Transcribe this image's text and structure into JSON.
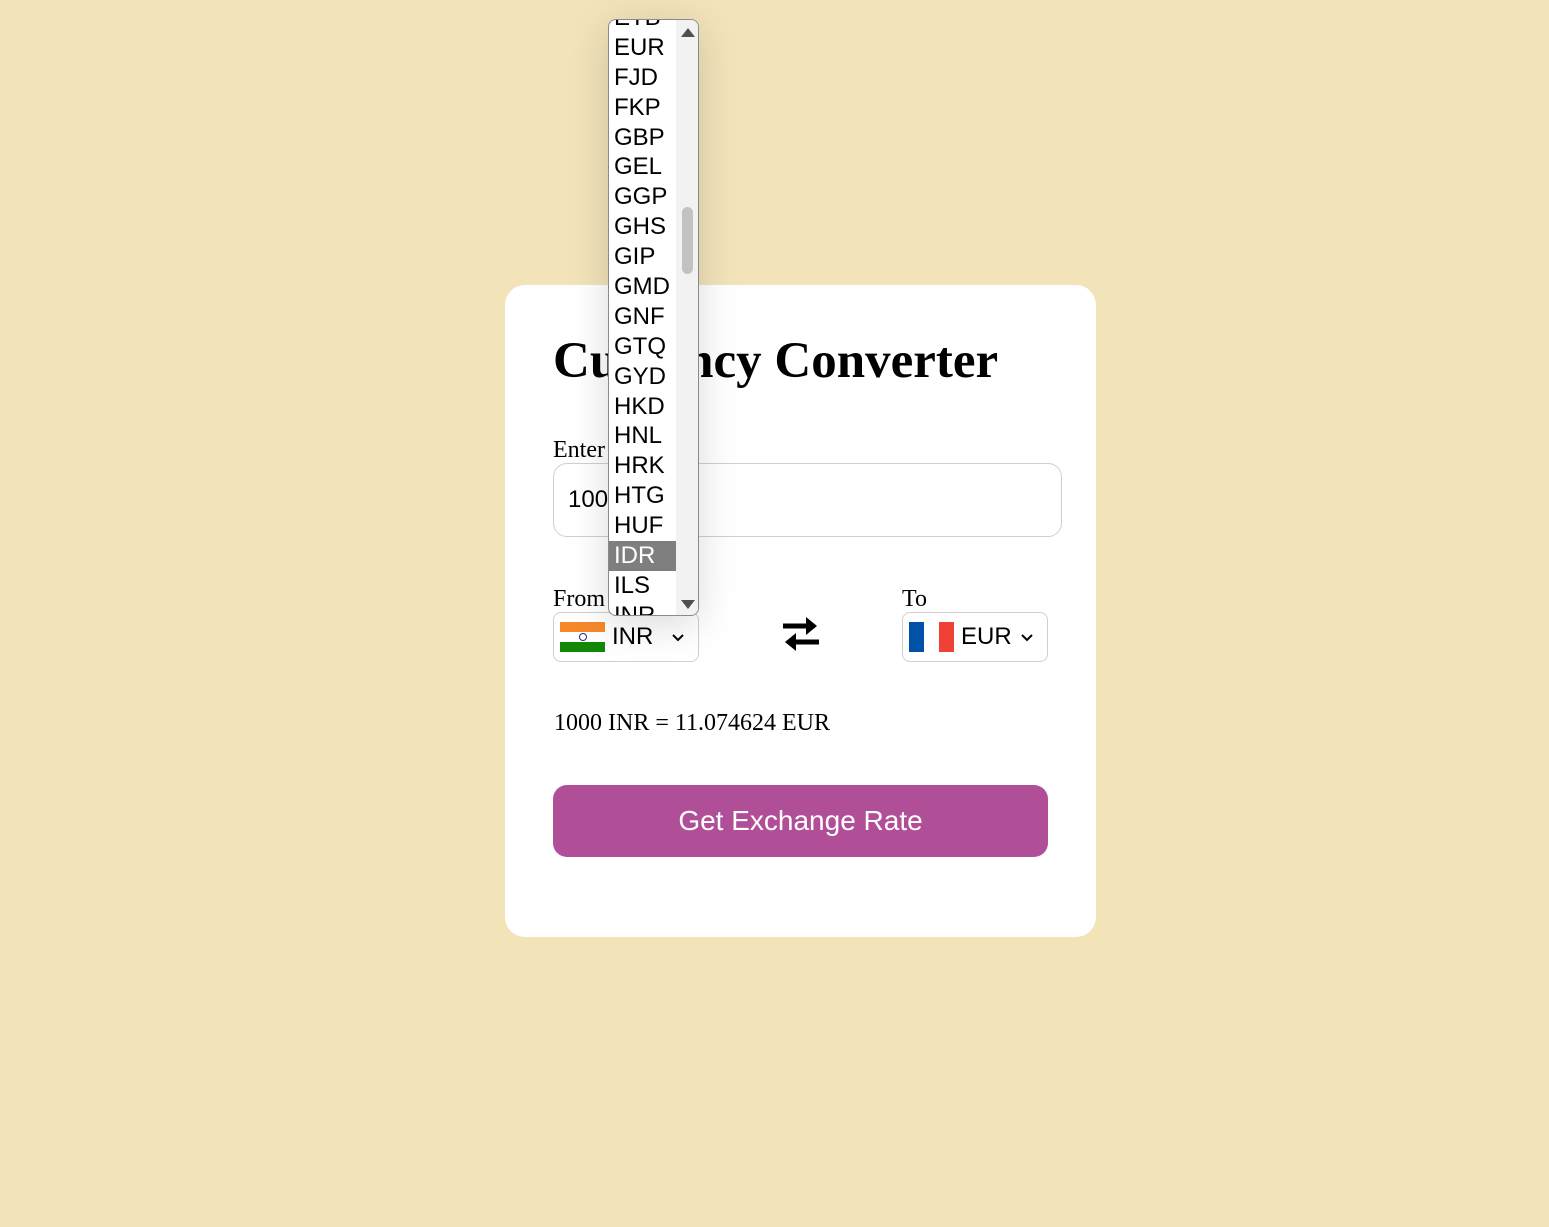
{
  "app": {
    "title": "Currency Converter"
  },
  "amount": {
    "label": "Enter Amount",
    "value": "1000"
  },
  "from": {
    "label": "From",
    "currency": "INR",
    "flag": "india-flag-icon"
  },
  "to": {
    "label": "To",
    "currency": "EUR",
    "flag": "france-flag-icon"
  },
  "swap_icon": "swap-arrows-icon",
  "result": "1000 INR = 11.074624 EUR",
  "button": {
    "label": "Get Exchange Rate",
    "color": "#b04f98"
  },
  "dropdown": {
    "options": [
      "ETB",
      "EUR",
      "FJD",
      "FKP",
      "GBP",
      "GEL",
      "GGP",
      "GHS",
      "GIP",
      "GMD",
      "GNF",
      "GTQ",
      "GYD",
      "HKD",
      "HNL",
      "HRK",
      "HTG",
      "HUF",
      "IDR",
      "ILS",
      "INR"
    ],
    "highlighted": "IDR"
  },
  "colors": {
    "background": "#f2e3b9",
    "card": "#ffffff",
    "highlight": "#7f7f7f"
  }
}
